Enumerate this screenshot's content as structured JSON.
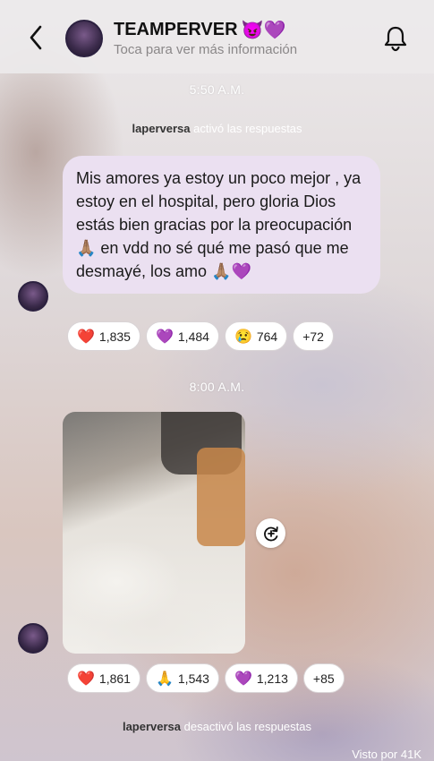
{
  "header": {
    "title": "TEAMPERVER",
    "title_emojis": "😈💜",
    "subtitle": "Toca para ver más información"
  },
  "messages": {
    "time1": "5:50 A.M.",
    "system1_user": "laperversa",
    "system1_action": "activó las respuestas",
    "text": "Mis amores ya estoy un poco mejor , ya estoy en el hospital, pero gloria Dios estás bien gracias por la preocupación 🙏🏽 en vdd no sé qué me pasó que me desmayé, los amo 🙏🏽💜",
    "reactions1": [
      {
        "emoji": "❤️",
        "count": "1,835"
      },
      {
        "emoji": "💜",
        "count": "1,484"
      },
      {
        "emoji": "😢",
        "count": "764"
      },
      {
        "emoji": "",
        "count": "+72"
      }
    ],
    "time2": "8:00 A.M.",
    "reactions2": [
      {
        "emoji": "❤️",
        "count": "1,861"
      },
      {
        "emoji": "🙏",
        "count": "1,543"
      },
      {
        "emoji": "💜",
        "count": "1,213"
      },
      {
        "emoji": "",
        "count": "+85"
      }
    ],
    "system2_user": "laperversa",
    "system2_action": "desactivó las respuestas",
    "seen": "Visto por 41K"
  },
  "colors": {
    "bubble": "#ebe0f1",
    "title": "#111111",
    "subtitle": "#8a8788"
  },
  "icons": [
    "back-arrow-icon",
    "bell-icon",
    "share-icon"
  ]
}
